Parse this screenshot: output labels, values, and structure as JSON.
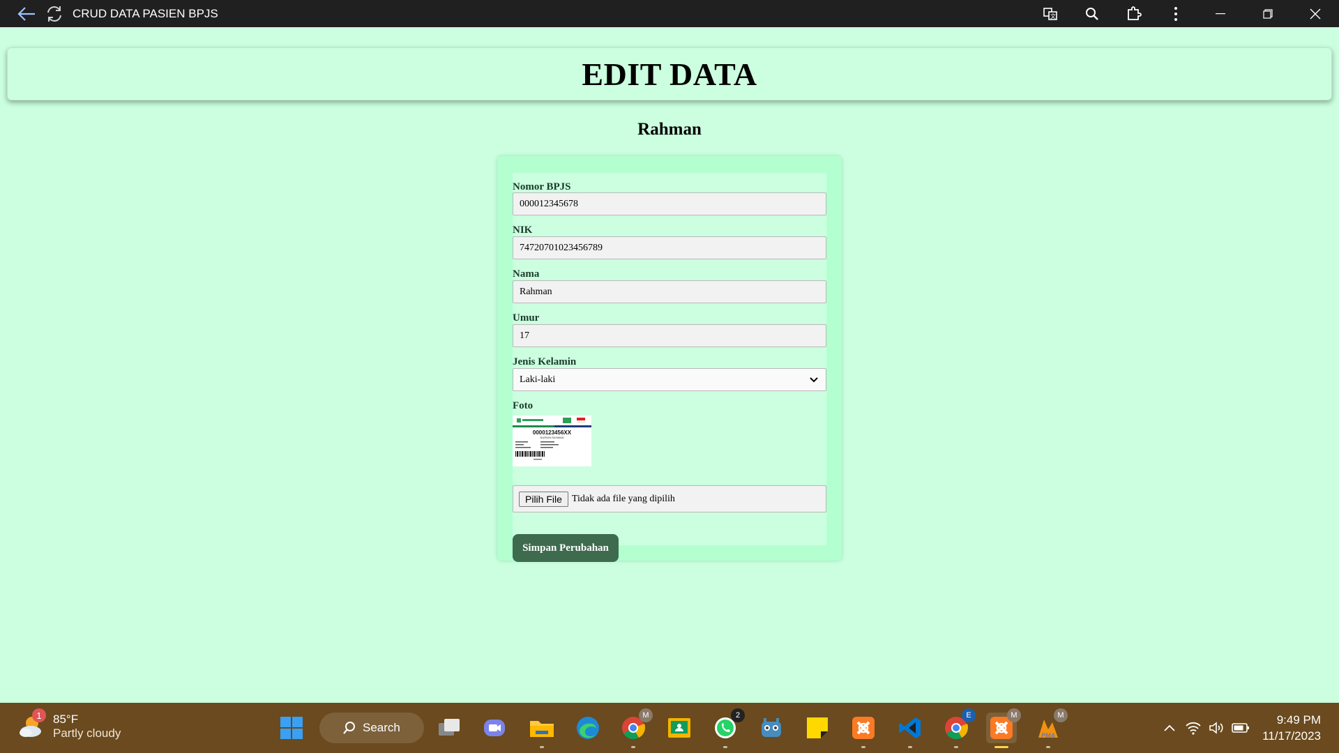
{
  "window": {
    "title": "CRUD DATA PASIEN BPJS"
  },
  "header": {
    "title": "EDIT DATA"
  },
  "patient": {
    "name": "Rahman"
  },
  "form": {
    "fields": [
      {
        "label": "Nomor BPJS",
        "value": "000012345678"
      },
      {
        "label": "NIK",
        "value": "74720701023456789"
      },
      {
        "label": "Nama",
        "value": "Rahman"
      },
      {
        "label": "Umur",
        "value": "17"
      }
    ],
    "gender": {
      "label": "Jenis Kelamin",
      "value": "Laki-laki"
    },
    "photo": {
      "label": "Foto",
      "card_number": "0000123456XX",
      "card_name": "NURDIN RAHMAN"
    },
    "file": {
      "button_label": "Pilih File",
      "status": "Tidak ada file yang dipilih"
    },
    "submit_label": "Simpan Perubahan"
  },
  "taskbar": {
    "weather": {
      "badge": "1",
      "temp": "85°F",
      "desc": "Partly cloudy"
    },
    "search_label": "Search",
    "badges": {
      "chrome1": "M",
      "whatsapp": "2",
      "chrome2": "E",
      "xampp2": "M",
      "pma": "M"
    },
    "clock": {
      "time": "9:49 PM",
      "date": "11/17/2023"
    }
  },
  "colors": {
    "page_bg": "#ccffe0",
    "form_border": "#b3ffd0",
    "button": "#3e6b4e",
    "titlebar": "#202020",
    "taskbar": "#6a4a1e"
  }
}
